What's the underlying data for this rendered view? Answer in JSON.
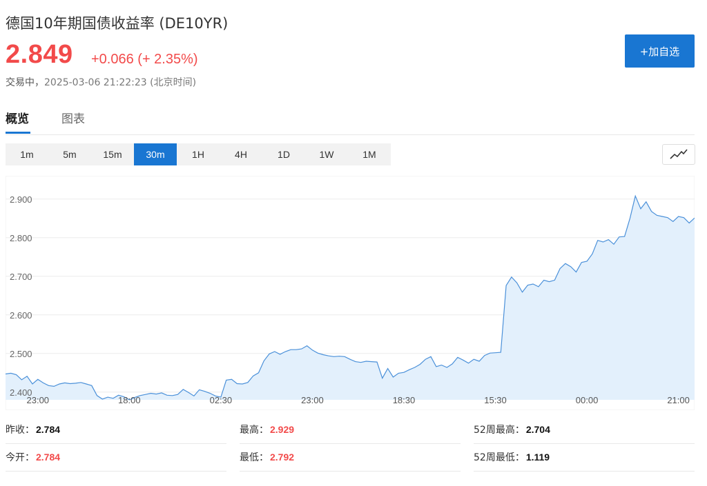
{
  "header": {
    "title": "德国10年期国债收益率  (DE10YR)",
    "price": "2.849",
    "change": "+0.066 (+ 2.35%)",
    "status_label": "交易中，",
    "timestamp": "2025-03-06 21:22:23 (北京时间)",
    "add_button": "+加自选"
  },
  "tabs": [
    {
      "label": "概览",
      "active": true
    },
    {
      "label": "图表",
      "active": false
    }
  ],
  "intervals": [
    "1m",
    "5m",
    "15m",
    "30m",
    "1H",
    "4H",
    "1D",
    "1W",
    "1M"
  ],
  "active_interval": "30m",
  "chart_type_icon": "line-chart-icon",
  "colors": {
    "up": "#f24a4a",
    "accent": "#1976d2",
    "line": "#4a90d9",
    "fill": "#e3f0fc"
  },
  "chart_data": {
    "type": "area",
    "title": "",
    "xlabel": "",
    "ylabel": "",
    "ylim": [
      2.38,
      2.955
    ],
    "y_ticks": [
      "2.900",
      "2.800",
      "2.700",
      "2.600",
      "2.500",
      "2.400"
    ],
    "y_tick_values": [
      2.9,
      2.8,
      2.7,
      2.6,
      2.5,
      2.4
    ],
    "x_tick_labels": [
      "23:00",
      "18:00",
      "02:30",
      "23:00",
      "18:30",
      "15:30",
      "00:00",
      "21:00"
    ],
    "x_tick_indices": [
      6,
      23,
      40,
      57,
      74,
      91,
      108,
      125
    ],
    "grid": true,
    "series": [
      {
        "values": [
          2.447,
          2.449,
          2.445,
          2.432,
          2.441,
          2.421,
          2.433,
          2.424,
          2.417,
          2.415,
          2.421,
          2.424,
          2.422,
          2.423,
          2.425,
          2.421,
          2.417,
          2.391,
          2.382,
          2.387,
          2.384,
          2.392,
          2.388,
          2.38,
          2.386,
          2.391,
          2.394,
          2.397,
          2.395,
          2.398,
          2.392,
          2.391,
          2.394,
          2.407,
          2.399,
          2.39,
          2.406,
          2.402,
          2.397,
          2.39,
          2.387,
          2.431,
          2.433,
          2.422,
          2.421,
          2.425,
          2.442,
          2.45,
          2.481,
          2.499,
          2.505,
          2.498,
          2.505,
          2.51,
          2.51,
          2.512,
          2.52,
          2.509,
          2.501,
          2.497,
          2.494,
          2.492,
          2.493,
          2.492,
          2.485,
          2.479,
          2.477,
          2.48,
          2.479,
          2.478,
          2.436,
          2.461,
          2.439,
          2.449,
          2.451,
          2.458,
          2.464,
          2.472,
          2.485,
          2.492,
          2.466,
          2.47,
          2.464,
          2.473,
          2.49,
          2.483,
          2.475,
          2.485,
          2.48,
          2.495,
          2.501,
          2.502,
          2.503,
          2.676,
          2.698,
          2.683,
          2.659,
          2.677,
          2.68,
          2.673,
          2.69,
          2.686,
          2.69,
          2.72,
          2.733,
          2.725,
          2.711,
          2.736,
          2.739,
          2.758,
          2.793,
          2.789,
          2.795,
          2.783,
          2.802,
          2.803,
          2.85,
          2.908,
          2.875,
          2.893,
          2.868,
          2.858,
          2.855,
          2.852,
          2.842,
          2.855,
          2.852,
          2.838,
          2.851
        ]
      }
    ]
  },
  "stats": [
    {
      "label": "昨收：",
      "value": "2.784",
      "color": "dark"
    },
    {
      "label": "最高：",
      "value": "2.929",
      "color": "red"
    },
    {
      "label": "52周最高：",
      "value": "2.704",
      "color": "dark"
    },
    {
      "label": "今开：",
      "value": "2.784",
      "color": "red"
    },
    {
      "label": "最低：",
      "value": "2.792",
      "color": "red"
    },
    {
      "label": "52周最低：",
      "value": "1.119",
      "color": "dark"
    }
  ]
}
